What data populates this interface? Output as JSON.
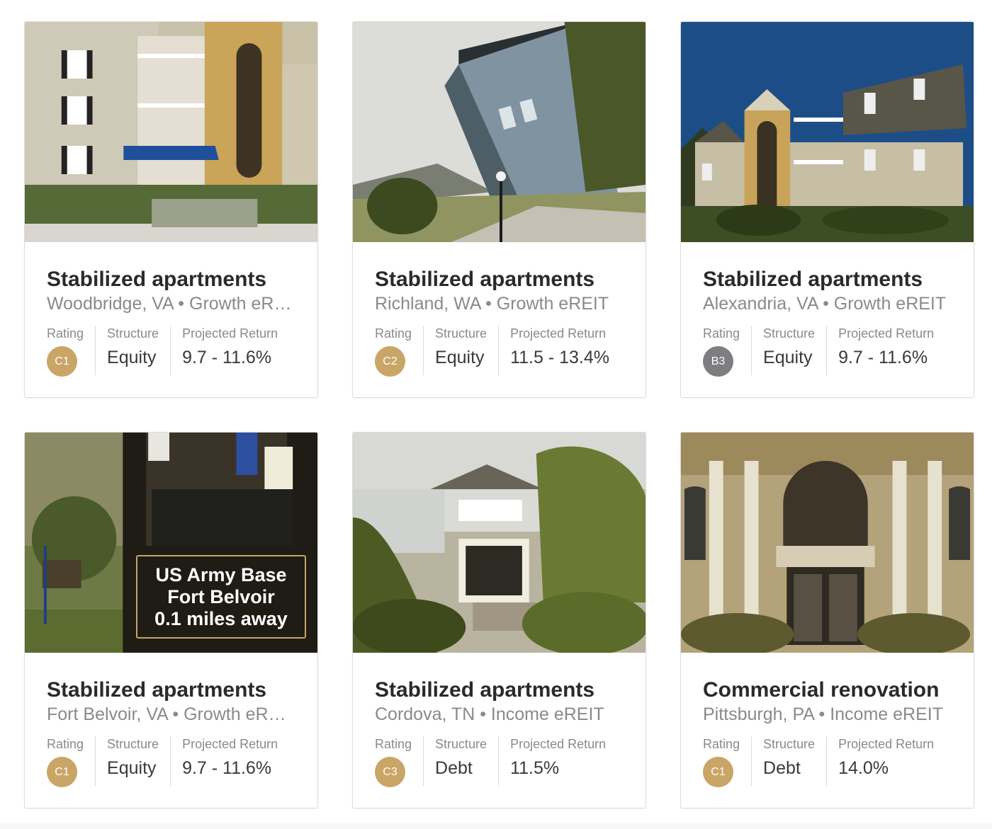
{
  "colors": {
    "rating_gold": "#c9a566",
    "rating_gray": "#7d7d82",
    "title": "#2a2a2a",
    "muted": "#8a8a8a"
  },
  "labels": {
    "rating": "Rating",
    "structure": "Structure",
    "projected_return": "Projected Return"
  },
  "cards": [
    {
      "image": "apartment-complex-woodbridge-photo",
      "title": "Stabilized apartments",
      "subtitle": "Woodbridge, VA • Growth eREIT",
      "rating": "C1",
      "rating_color": "#c9a566",
      "structure": "Equity",
      "projected_return": "9.7 - 11.6%"
    },
    {
      "image": "apartment-complex-richland-photo",
      "title": "Stabilized apartments",
      "subtitle": "Richland, WA • Growth eREIT",
      "rating": "C2",
      "rating_color": "#c9a566",
      "structure": "Equity",
      "projected_return": "11.5 - 13.4%"
    },
    {
      "image": "apartment-complex-alexandria-photo",
      "title": "Stabilized apartments",
      "subtitle": "Alexandria, VA • Growth eREIT",
      "rating": "B3",
      "rating_color": "#7d7d82",
      "structure": "Equity",
      "projected_return": "9.7 - 11.6%"
    },
    {
      "image": "army-base-fort-belvoir-photo",
      "overlay": [
        "US Army Base",
        "Fort Belvoir",
        "0.1 miles away"
      ],
      "title": "Stabilized apartments",
      "subtitle": "Fort Belvoir, VA • Growth eREIT",
      "rating": "C1",
      "rating_color": "#c9a566",
      "structure": "Equity",
      "projected_return": "9.7 - 11.6%"
    },
    {
      "image": "apartment-complex-cordova-photo",
      "title": "Stabilized apartments",
      "subtitle": "Cordova, TN • Income eREIT",
      "rating": "C3",
      "rating_color": "#c9a566",
      "structure": "Debt",
      "projected_return": "11.5%"
    },
    {
      "image": "historic-building-pittsburgh-photo",
      "title": "Commercial renovation",
      "subtitle": "Pittsburgh, PA • Income eREIT",
      "rating": "C1",
      "rating_color": "#c9a566",
      "structure": "Debt",
      "projected_return": "14.0%"
    }
  ]
}
